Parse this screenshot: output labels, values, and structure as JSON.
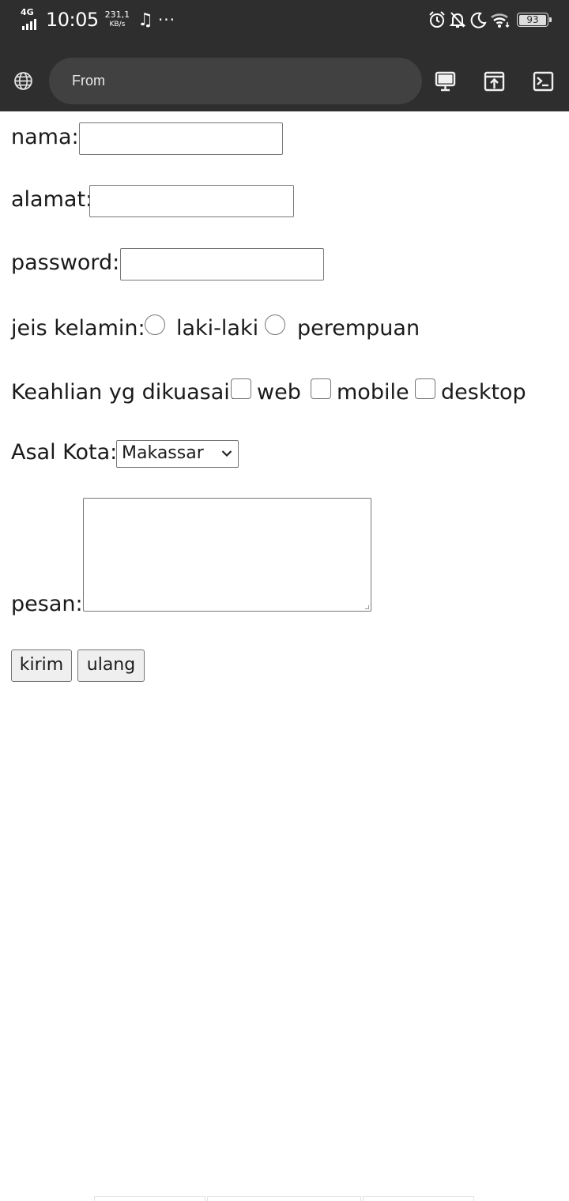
{
  "status_bar": {
    "network_type": "4G",
    "time": "10:05",
    "speed_value": "231,1",
    "speed_unit": "KB/s",
    "media_icon": "music-note-icon",
    "more_indicator": "···",
    "battery_level": "93",
    "icons": [
      "alarm-icon",
      "bell-off-icon",
      "moon-icon",
      "wifi-icon",
      "battery-icon"
    ]
  },
  "browser": {
    "url_text": "From",
    "icons": [
      "globe-icon",
      "desktop-icon",
      "open-in-icon",
      "terminal-icon"
    ]
  },
  "form": {
    "nama_label": "nama:",
    "nama_value": "",
    "alamat_label": "alamat:",
    "alamat_value": "",
    "password_label": "password:",
    "password_value": "",
    "gender_label": "jeis kelamin:",
    "gender_options": [
      "laki-laki",
      "perempuan"
    ],
    "skills_label": "Keahlian yg dikuasai:",
    "skills_options": [
      "web",
      "mobile",
      "desktop"
    ],
    "city_label": "Asal Kota:",
    "city_selected": "Makassar",
    "message_label": "pesan:",
    "message_value": "",
    "submit_label": "kirim",
    "reset_label": "ulang"
  },
  "colors": {
    "chrome_bg": "#2e2e2e",
    "urlbar_bg": "#414141",
    "input_border": "#767676",
    "button_bg": "#efefef"
  }
}
